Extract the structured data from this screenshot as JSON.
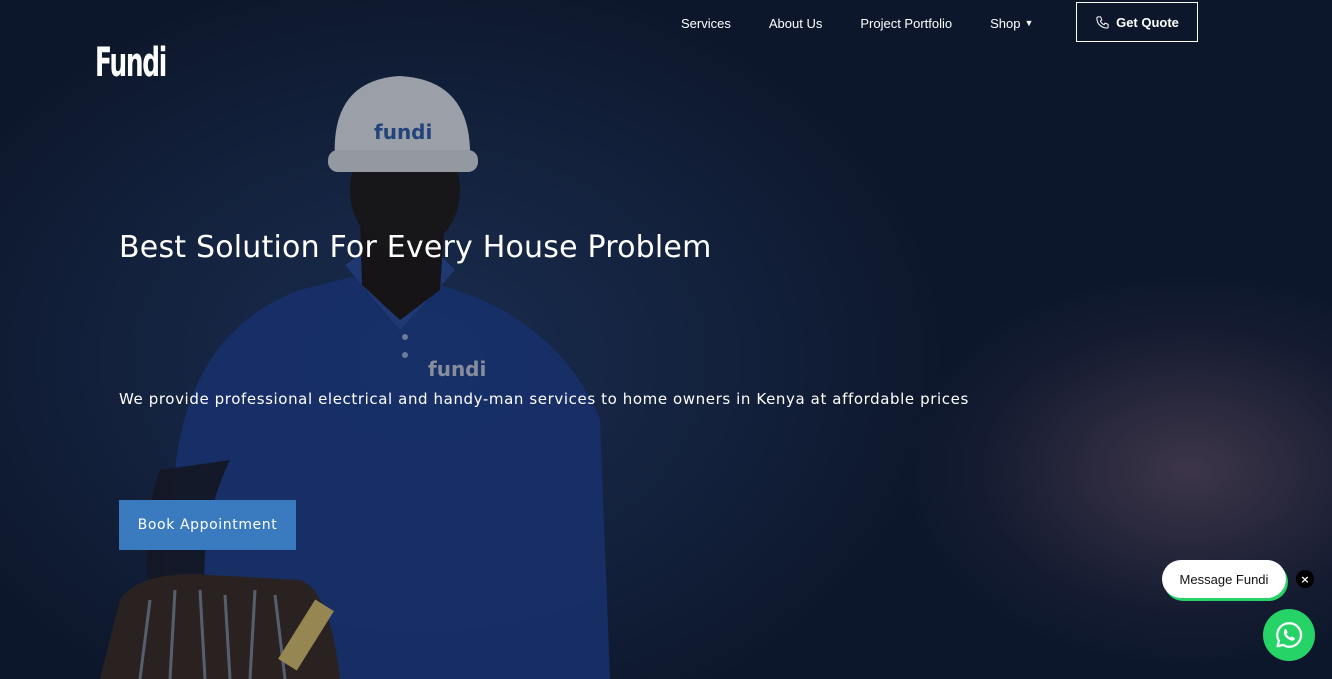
{
  "brand": {
    "logo_text": "Fundi"
  },
  "nav": {
    "items": [
      {
        "label": "Services"
      },
      {
        "label": "About Us"
      },
      {
        "label": "Project Portfolio"
      },
      {
        "label": "Shop"
      }
    ],
    "quote_label": "Get Quote"
  },
  "hero": {
    "image_lettering": [
      "fundi",
      "fundi"
    ],
    "title": "Best Solution For Every House Problem",
    "subtitle": "We provide professional electrical and handy-man services to home owners in Kenya at affordable prices",
    "cta_label": "Book Appointment"
  },
  "chat": {
    "bubble_label": "Message Fundi",
    "close_glyph": "×",
    "button_icon": "whatsapp-icon"
  },
  "colors": {
    "accent_button": "#3a7bbf",
    "whatsapp_green": "#25d366"
  }
}
